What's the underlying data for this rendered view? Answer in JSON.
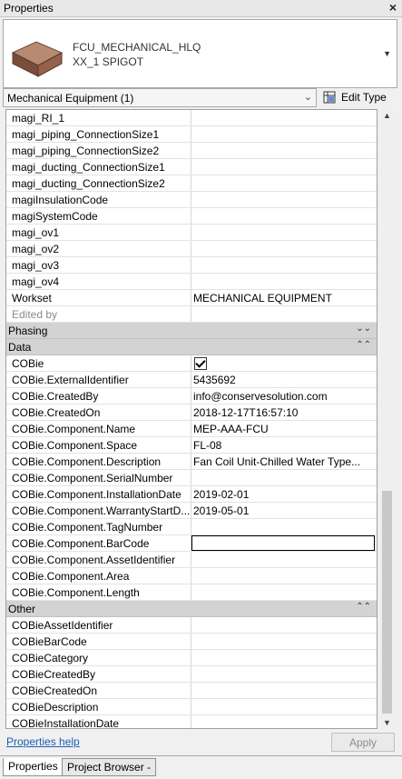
{
  "panel": {
    "title": "Properties"
  },
  "type_selector": {
    "line1": "FCU_MECHANICAL_HLQ",
    "line2": "XX_1 SPIGOT"
  },
  "filter": {
    "selected": "Mechanical Equipment (1)"
  },
  "edit_type": {
    "label": "Edit Type"
  },
  "rows_top": [
    {
      "k": "magi_RI_1",
      "v": ""
    },
    {
      "k": "magi_piping_ConnectionSize1",
      "v": ""
    },
    {
      "k": "magi_piping_ConnectionSize2",
      "v": ""
    },
    {
      "k": "magi_ducting_ConnectionSize1",
      "v": ""
    },
    {
      "k": "magi_ducting_ConnectionSize2",
      "v": ""
    },
    {
      "k": "magiInsulationCode",
      "v": ""
    },
    {
      "k": "magiSystemCode",
      "v": ""
    },
    {
      "k": "magi_ov1",
      "v": ""
    },
    {
      "k": "magi_ov2",
      "v": ""
    },
    {
      "k": "magi_ov3",
      "v": ""
    },
    {
      "k": "magi_ov4",
      "v": ""
    },
    {
      "k": "Workset",
      "v": "MECHANICAL EQUIPMENT"
    },
    {
      "k": "Edited by",
      "v": ""
    }
  ],
  "groups": {
    "phasing": "Phasing",
    "data": "Data",
    "other": "Other"
  },
  "rows_data": [
    {
      "k": "COBie",
      "v": ""
    },
    {
      "k": "COBie.ExternalIdentifier",
      "v": "5435692"
    },
    {
      "k": "COBie.CreatedBy",
      "v": "info@conservesolution.com"
    },
    {
      "k": "COBie.CreatedOn",
      "v": "2018-12-17T16:57:10"
    },
    {
      "k": "COBie.Component.Name",
      "v": "MEP-AAA-FCU"
    },
    {
      "k": "COBie.Component.Space",
      "v": "FL-08"
    },
    {
      "k": "COBie.Component.Description",
      "v": "Fan Coil Unit-Chilled Water Type..."
    },
    {
      "k": "COBie.Component.SerialNumber",
      "v": ""
    },
    {
      "k": "COBie.Component.InstallationDate",
      "v": "2019-02-01"
    },
    {
      "k": "COBie.Component.WarrantyStartD...",
      "v": "2019-05-01"
    },
    {
      "k": "COBie.Component.TagNumber",
      "v": ""
    },
    {
      "k": "COBie.Component.BarCode",
      "v": ""
    },
    {
      "k": "COBie.Component.AssetIdentifier",
      "v": ""
    },
    {
      "k": "COBie.Component.Area",
      "v": ""
    },
    {
      "k": "COBie.Component.Length",
      "v": ""
    }
  ],
  "rows_other": [
    {
      "k": "COBieAssetIdentifier",
      "v": ""
    },
    {
      "k": "COBieBarCode",
      "v": ""
    },
    {
      "k": "COBieCategory",
      "v": ""
    },
    {
      "k": "COBieCreatedBy",
      "v": ""
    },
    {
      "k": "COBieCreatedOn",
      "v": ""
    },
    {
      "k": "COBieDescription",
      "v": ""
    },
    {
      "k": "COBieInstallationDate",
      "v": ""
    }
  ],
  "footer": {
    "help": "Properties help",
    "apply": "Apply"
  },
  "tabs": [
    "Properties",
    "Project Browser -"
  ]
}
